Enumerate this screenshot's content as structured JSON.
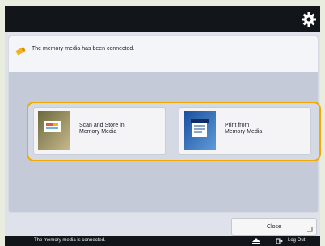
{
  "message": {
    "text": "The memory media has been connected."
  },
  "options": [
    {
      "label_line1": "Scan and Store in",
      "label_line2": "Memory Media",
      "icon": "scan-to-memory-icon"
    },
    {
      "label_line1": "Print from",
      "label_line2": "Memory Media",
      "icon": "print-from-memory-icon"
    }
  ],
  "footer": {
    "close_label": "Close"
  },
  "status": {
    "text": "The memory media is connected.",
    "logout_label": "Log Out"
  },
  "colors": {
    "accent": "#f2a900",
    "bar": "#121519",
    "panel": "#c4cad8"
  }
}
